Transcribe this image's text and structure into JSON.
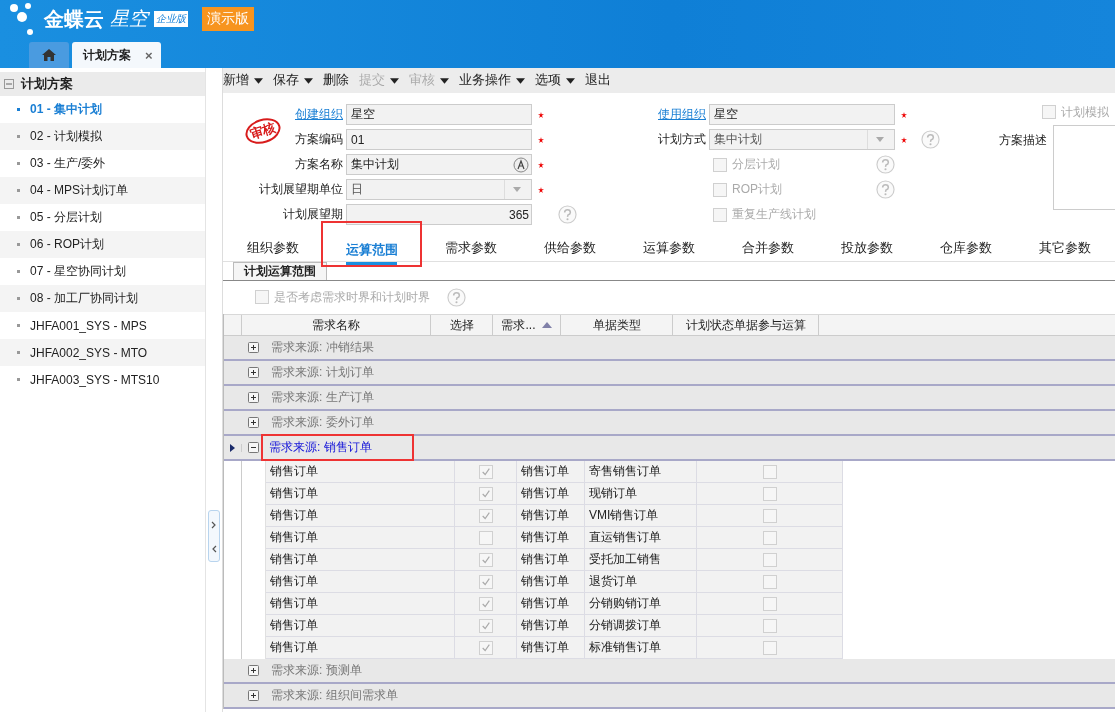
{
  "header": {
    "logo": "金蝶云",
    "product": "星空",
    "edition": "企业版",
    "demo_badge": "演示版"
  },
  "doc_tabs": [
    {
      "kind": "home",
      "selected": false
    },
    {
      "kind": "page",
      "label": "计划方案",
      "selected": true,
      "close": "×"
    }
  ],
  "sidebar": {
    "title": "计划方案",
    "expanded": true,
    "items": [
      {
        "label": "01 - 集中计划",
        "selected": true
      },
      {
        "label": "02 - 计划模拟",
        "selected": false
      },
      {
        "label": "03 - 生产/委外",
        "selected": false
      },
      {
        "label": "04 - MPS计划订单",
        "selected": false
      },
      {
        "label": "05 - 分层计划",
        "selected": false
      },
      {
        "label": "06 - ROP计划",
        "selected": false
      },
      {
        "label": "07 - 星空协同计划",
        "selected": false
      },
      {
        "label": "08 - 加工厂协同计划",
        "selected": false
      },
      {
        "label": "JHFA001_SYS - MPS",
        "selected": false
      },
      {
        "label": "JHFA002_SYS - MTO",
        "selected": false
      },
      {
        "label": "JHFA003_SYS - MTS10",
        "selected": false
      }
    ]
  },
  "toolbar": [
    {
      "label": "新增",
      "dropdown": true,
      "disabled": false
    },
    {
      "label": "保存",
      "dropdown": true,
      "disabled": false
    },
    {
      "label": "删除",
      "dropdown": false,
      "disabled": false
    },
    {
      "label": "提交",
      "dropdown": true,
      "disabled": true
    },
    {
      "label": "审核",
      "dropdown": true,
      "disabled": true
    },
    {
      "label": "业务操作",
      "dropdown": true,
      "disabled": false
    },
    {
      "label": "选项",
      "dropdown": true,
      "disabled": false
    },
    {
      "label": "退出",
      "dropdown": false,
      "disabled": false
    }
  ],
  "stamp": "审核",
  "form_left": [
    {
      "label": "创建组织",
      "value": "星空",
      "kind": "text",
      "link": true,
      "required": true,
      "help": false
    },
    {
      "label": "方案编码",
      "value": "01",
      "kind": "text",
      "link": false,
      "required": true,
      "help": false
    },
    {
      "label": "方案名称",
      "value": "集中计划",
      "kind": "lookup",
      "link": false,
      "required": true,
      "help": false
    },
    {
      "label": "计划展望期单位",
      "value": "日",
      "kind": "select",
      "link": false,
      "required": true,
      "help": false
    },
    {
      "label": "计划展望期",
      "value": "365",
      "kind": "number",
      "link": false,
      "required": false,
      "help": true
    }
  ],
  "form_right": [
    {
      "label": "使用组织",
      "value": "星空",
      "kind": "text",
      "link": true,
      "required": true,
      "help": false
    },
    {
      "label": "计划方式",
      "value": "集中计划",
      "kind": "select",
      "link": false,
      "required": true,
      "help": true
    }
  ],
  "form_right_checks": [
    {
      "label": "分层计划",
      "checked": false,
      "help": true
    },
    {
      "label": "ROP计划",
      "checked": false,
      "help": true
    },
    {
      "label": "重复生产线计划",
      "checked": false,
      "help": false
    }
  ],
  "simulation_check": {
    "label": "计划模拟",
    "checked": false
  },
  "description": {
    "label": "方案描述"
  },
  "param_tabs": [
    {
      "label": "组织参数",
      "selected": false,
      "highlighted": false
    },
    {
      "label": "运算范围",
      "selected": true,
      "highlighted": true
    },
    {
      "label": "需求参数",
      "selected": false,
      "highlighted": false
    },
    {
      "label": "供给参数",
      "selected": false,
      "highlighted": false
    },
    {
      "label": "运算参数",
      "selected": false,
      "highlighted": false
    },
    {
      "label": "合并参数",
      "selected": false,
      "highlighted": false
    },
    {
      "label": "投放参数",
      "selected": false,
      "highlighted": false
    },
    {
      "label": "仓库参数",
      "selected": false,
      "highlighted": false
    },
    {
      "label": "其它参数",
      "selected": false,
      "highlighted": false
    }
  ],
  "sub_tab": {
    "label": "计划运算范围",
    "selected": true
  },
  "time_fence_check": {
    "label": "是否考虑需求时界和计划时界",
    "checked": false,
    "help": true
  },
  "table": {
    "columns": [
      {
        "label": "需求名称",
        "sorted": false
      },
      {
        "label": "选择",
        "sorted": false
      },
      {
        "label": "需求...",
        "sorted": true
      },
      {
        "label": "单据类型",
        "sorted": false
      },
      {
        "label": "计划状态单据参与运算",
        "sorted": false
      }
    ],
    "groups": [
      {
        "label": "需求来源: 冲销结果",
        "expanded": false,
        "current": false,
        "highlighted": false
      },
      {
        "label": "需求来源: 计划订单",
        "expanded": false,
        "current": false,
        "highlighted": false
      },
      {
        "label": "需求来源: 生产订单",
        "expanded": false,
        "current": false,
        "highlighted": false
      },
      {
        "label": "需求来源: 委外订单",
        "expanded": false,
        "current": false,
        "highlighted": false
      },
      {
        "label": "需求来源: 销售订单",
        "expanded": true,
        "current": true,
        "highlighted": true,
        "rows": [
          {
            "name": "销售订单",
            "checked": true,
            "source": "销售订单",
            "doc_type": "寄售销售订单",
            "participate": false
          },
          {
            "name": "销售订单",
            "checked": true,
            "source": "销售订单",
            "doc_type": "现销订单",
            "participate": false
          },
          {
            "name": "销售订单",
            "checked": true,
            "source": "销售订单",
            "doc_type": "VMI销售订单",
            "participate": false
          },
          {
            "name": "销售订单",
            "checked": false,
            "source": "销售订单",
            "doc_type": "直运销售订单",
            "participate": false
          },
          {
            "name": "销售订单",
            "checked": true,
            "source": "销售订单",
            "doc_type": "受托加工销售",
            "participate": false
          },
          {
            "name": "销售订单",
            "checked": true,
            "source": "销售订单",
            "doc_type": "退货订单",
            "participate": false
          },
          {
            "name": "销售订单",
            "checked": true,
            "source": "销售订单",
            "doc_type": "分销购销订单",
            "participate": false
          },
          {
            "name": "销售订单",
            "checked": true,
            "source": "销售订单",
            "doc_type": "分销调拨订单",
            "participate": false
          },
          {
            "name": "销售订单",
            "checked": true,
            "source": "销售订单",
            "doc_type": "标准销售订单",
            "participate": false
          }
        ]
      },
      {
        "label": "需求来源: 预测单",
        "expanded": false,
        "current": false,
        "highlighted": false
      },
      {
        "label": "需求来源: 组织间需求单",
        "expanded": false,
        "current": false,
        "highlighted": false
      }
    ]
  }
}
